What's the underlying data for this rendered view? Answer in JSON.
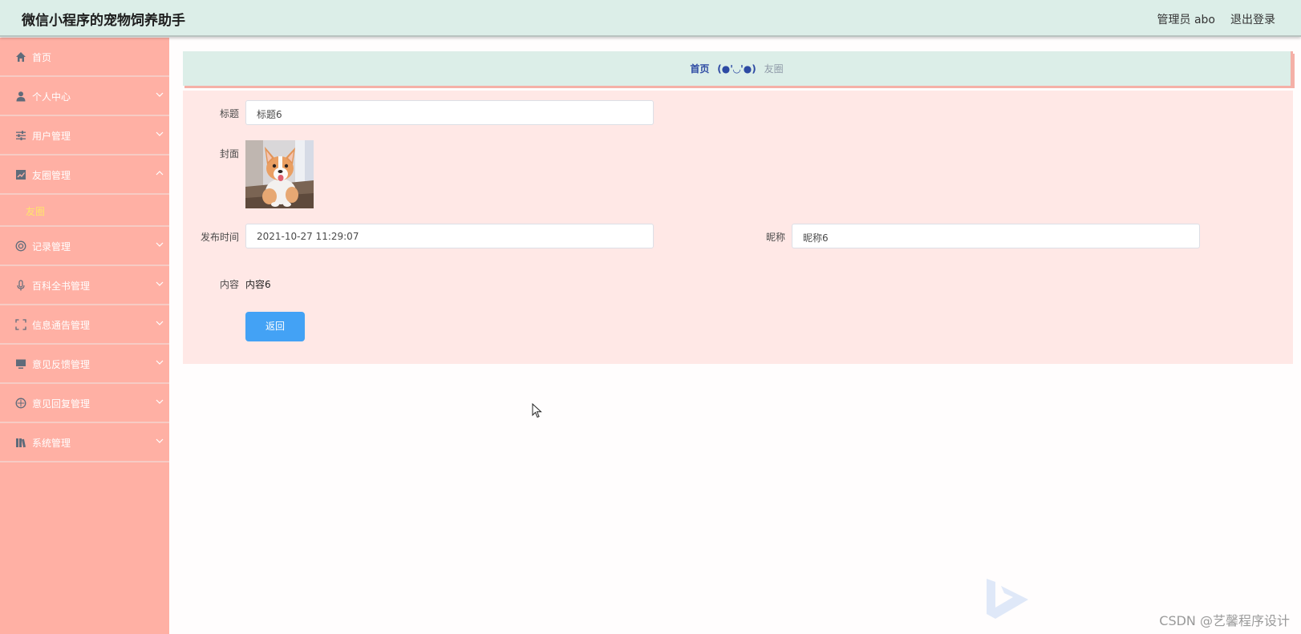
{
  "header": {
    "title": "微信小程序的宠物饲养助手",
    "user_label": "管理员 abo",
    "logout_label": "退出登录"
  },
  "sidebar": {
    "items": [
      {
        "label": "首页",
        "icon": "home-icon"
      },
      {
        "label": "个人中心",
        "icon": "user-icon"
      },
      {
        "label": "用户管理",
        "icon": "sliders-icon"
      },
      {
        "label": "友圈管理",
        "icon": "chart-icon"
      },
      {
        "label": "记录管理",
        "icon": "lifebuoy-icon"
      },
      {
        "label": "百科全书管理",
        "icon": "microphone-icon"
      },
      {
        "label": "信息通告管理",
        "icon": "fullscreen-icon"
      },
      {
        "label": "意见反馈管理",
        "icon": "monitor-icon"
      },
      {
        "label": "意见回复管理",
        "icon": "compass-icon"
      },
      {
        "label": "系统管理",
        "icon": "books-icon"
      }
    ],
    "submenu_label": "友圈"
  },
  "breadcrumb": {
    "home": "首页",
    "separator": "(●'◡'●)",
    "current": "友圈"
  },
  "form": {
    "title_label": "标题",
    "title_value": "标题6",
    "cover_label": "封面",
    "time_label": "发布时间",
    "time_value": "2021-10-27 11:29:07",
    "nickname_label": "昵称",
    "nickname_value": "昵称6",
    "content_label": "内容",
    "content_value": "内容6",
    "back_button": "返回"
  },
  "watermark": "CSDN @艺馨程序设计",
  "colors": {
    "header_bg": "#dceee8",
    "sidebar_bg": "#ffb0a4",
    "submenu_active": "#ffe46b",
    "form_bg": "#ffe8e6",
    "button_primary": "#43a2f5"
  }
}
